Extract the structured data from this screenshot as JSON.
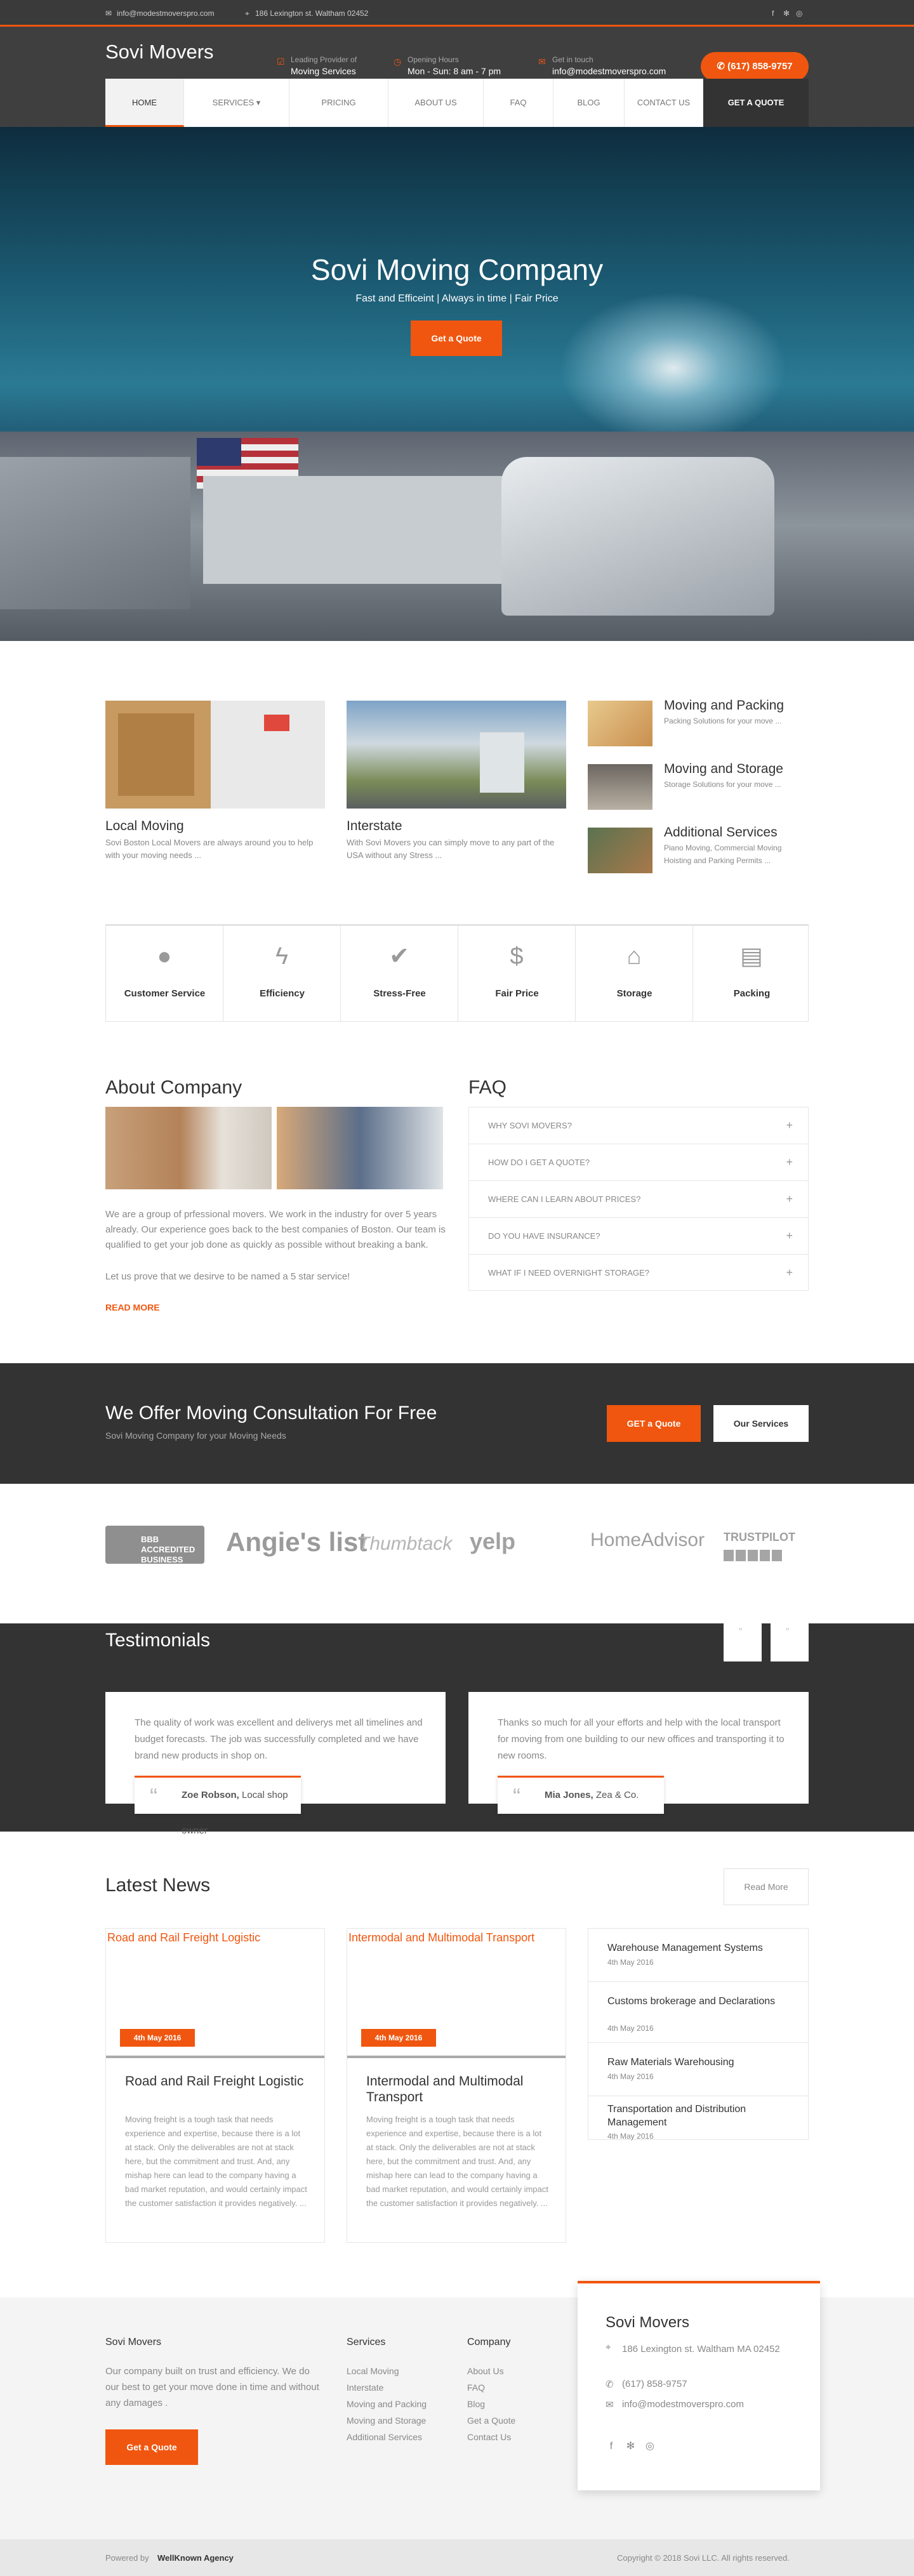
{
  "topbar": {
    "email": "info@modestmoverspro.com",
    "address": "186 Lexington st. Waltham 02452"
  },
  "header": {
    "logo": "Sovi Movers",
    "info": [
      {
        "label": "Leading Provider of",
        "value": "Moving Services",
        "icon": "check-icon"
      },
      {
        "label": "Opening Hours",
        "value": "Mon - Sun: 8 am - 7 pm",
        "icon": "clock-icon"
      },
      {
        "label": "Get in touch",
        "value": "info@modestmoverspro.com",
        "icon": "mail-icon"
      }
    ],
    "phone": "(617) 858-9757"
  },
  "nav": {
    "items": [
      "HOME",
      "SERVICES",
      "PRICING",
      "ABOUT US",
      "FAQ",
      "BLOG",
      "CONTACT US"
    ],
    "quote": "GET A QUOTE"
  },
  "hero": {
    "title": "Sovi Moving Company",
    "subtitle": "Fast and Efficeint | Always in time | Fair Price",
    "button": "Get a Quote"
  },
  "services_cards": [
    {
      "title": "Local Moving",
      "desc": "Sovi Boston Local Movers are always around you to help with your moving needs ..."
    },
    {
      "title": "Interstate",
      "desc": "With Sovi Movers you can simply move to any part of the USA without any Stress ..."
    }
  ],
  "services_side": [
    {
      "title": "Moving and Packing",
      "desc": "Packing Solutions for your move ..."
    },
    {
      "title": "Moving and Storage",
      "desc": "Storage Solutions for your move ..."
    },
    {
      "title": "Additional Services",
      "desc": "Piano Moving, Commercial Moving Hoisting and Parking Permits ..."
    }
  ],
  "features": [
    {
      "label": "Customer Service",
      "icon": "user-icon"
    },
    {
      "label": "Efficiency",
      "icon": "bolt-icon"
    },
    {
      "label": "Stress-Free",
      "icon": "check-icon"
    },
    {
      "label": "Fair Price",
      "icon": "dollar-icon"
    },
    {
      "label": "Storage",
      "icon": "home-icon"
    },
    {
      "label": "Packing",
      "icon": "archive-icon"
    }
  ],
  "about": {
    "title": "About Company",
    "text": "We are a group of prfessional movers. We work in the industry for over 5 years already. Our experience goes back to the best companies of Boston. Our team is qualified to get your job done as quickly as possible without breaking a bank.",
    "text2": "Let us prove that we desirve to be named a 5 star service!",
    "more": "READ MORE"
  },
  "faq": {
    "title": "FAQ",
    "items": [
      "WHY SOVI MOVERS?",
      "HOW DO I GET A QUOTE?",
      "WHERE CAN I LEARN ABOUT PRICES?",
      "DO YOU HAVE INSURANCE?",
      "WHAT IF I NEED OVERNIGHT STORAGE?"
    ]
  },
  "cta": {
    "title": "We Offer Moving Consultation For Free",
    "subtitle": "Sovi Moving Company for your Moving Needs",
    "btn1": "GET a Quote",
    "btn2": "Our Services"
  },
  "logos": [
    "BBB ACCREDITED BUSINESS",
    "Angie's list",
    "Thumbtack",
    "yelp",
    "HomeAdvisor",
    "TRUSTPILOT"
  ],
  "testimonials": {
    "title": "Testimonials",
    "items": [
      {
        "quote": "The quality of work was excellent and deliverys met all timelines and budget forecasts. The job was successfully completed and we have brand new products in shop on.",
        "name": "Zoe Robson,",
        "role": "Local shop owner"
      },
      {
        "quote": "Thanks so much for all your efforts and help with the local transport for moving from one building to our new offices and transporting it to new rooms.",
        "name": "Mia Jones,",
        "role": "Zea & Co."
      }
    ]
  },
  "news": {
    "title": "Latest News",
    "more": "Read More",
    "posts": [
      {
        "img_alt": "Road and Rail Freight Logistic",
        "date": "4th May 2016",
        "title": "Road and Rail Freight Logistic",
        "desc": "Moving freight is a tough task that needs experience and expertise, because there is a lot at stack. Only the deliverables are not at stack here, but the commitment and trust. And, any mishap here can lead to the company having a bad market reputation, and would certainly impact the customer satisfaction it provides negatively. ..."
      },
      {
        "img_alt": "Intermodal and Multimodal Transport",
        "date": "4th May 2016",
        "title": "Intermodal and Multimodal Transport",
        "desc": "Moving freight is a tough task that needs experience and expertise, because there is a lot at stack. Only the deliverables are not at stack here, but the commitment and trust. And, any mishap here can lead to the company having a bad market reputation, and would certainly impact the customer satisfaction it provides negatively. ..."
      }
    ],
    "side": [
      {
        "title": "Warehouse Management Systems",
        "date": "4th May 2016"
      },
      {
        "title": "Customs brokerage and Declarations",
        "date": "4th May 2016"
      },
      {
        "title": "Raw Materials Warehousing",
        "date": "4th May 2016"
      },
      {
        "title": "Transportation and Distribution Management",
        "date": "4th May 2016"
      }
    ]
  },
  "footer": {
    "about_title": "Sovi Movers",
    "about_text": "Our company built on trust and efficiency. We do our best to get your move done in time and without any damages .",
    "quote_btn": "Get a Quote",
    "services_title": "Services",
    "services": [
      "Local Moving",
      "Interstate",
      "Moving and Packing",
      "Moving and Storage",
      "Additional Services"
    ],
    "company_title": "Company",
    "company": [
      "About Us",
      "FAQ",
      "Blog",
      "Get a Quote",
      "Contact Us"
    ],
    "box": {
      "title": "Sovi Movers",
      "address": "186 Lexington st. Waltham MA 02452",
      "phone": "(617) 858-9757",
      "email": "info@modestmoverspro.com"
    },
    "powered_prefix": "Powered by",
    "powered": "WellKnown Agency",
    "copyright": "Copyright © 2018 Sovi LLC. All rights reserved."
  }
}
